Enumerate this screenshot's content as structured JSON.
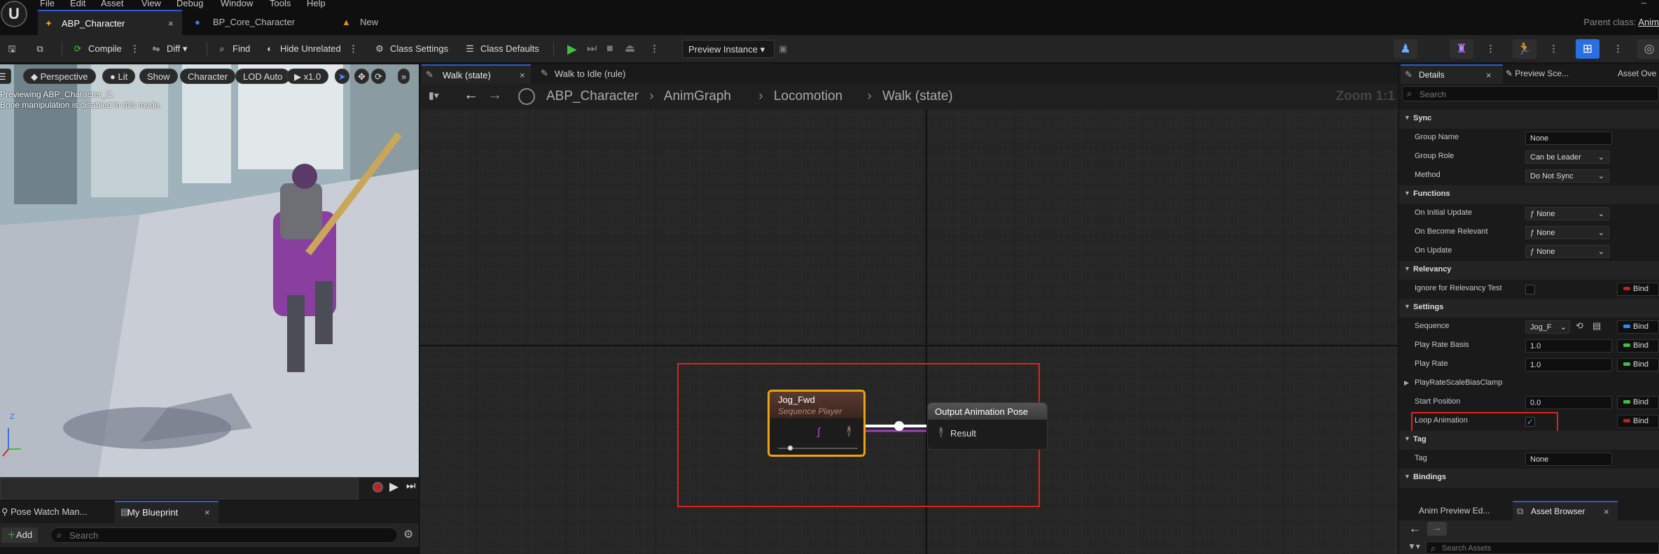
{
  "menu": [
    "File",
    "Edit",
    "Asset",
    "View",
    "Debug",
    "Window",
    "Tools",
    "Help"
  ],
  "tabs": [
    {
      "label": "ABP_Character",
      "close": "×"
    },
    {
      "label": "BP_Core_Character"
    },
    {
      "label": "New"
    }
  ],
  "parent_class": {
    "label": "Parent class:",
    "value": "Anim"
  },
  "toolbar": {
    "compile": "Compile",
    "diff": "Diff",
    "find": "Find",
    "hide_unrelated": "Hide Unrelated",
    "class_settings": "Class Settings",
    "class_defaults": "Class Defaults",
    "preview_instance": "Preview Instance"
  },
  "viewport": {
    "perspective": "Perspective",
    "lit": "Lit",
    "show": "Show",
    "character": "Character",
    "lod": "LOD Auto",
    "speed": "x1.0",
    "info_line1": "Previewing ABP_Character_C.",
    "info_line2": "Bone manipulation is disabled in this mode.",
    "axis_z": "Z"
  },
  "bottom_tabs": {
    "pose_watch": "Pose Watch Man...",
    "my_blueprint": "My Blueprint",
    "close": "×",
    "add": "Add",
    "search_placeholder": "Search"
  },
  "graph_tabs": {
    "walk_state": "Walk (state)",
    "walk_to_idle": "Walk to Idle (rule)",
    "close": "×"
  },
  "breadcrumb": [
    "ABP_Character",
    "AnimGraph",
    "Locomotion",
    "Walk (state)"
  ],
  "zoom": "Zoom 1:1",
  "nodes": {
    "seq_title": "Jog_Fwd",
    "seq_subtitle": "Sequence Player",
    "out_title": "Output Animation Pose",
    "out_pin": "Result"
  },
  "details": {
    "tab_details": "Details",
    "tab_preview": "Preview Sce...",
    "tab_asset": "Asset Ove",
    "close": "×",
    "search_placeholder": "Search",
    "cat_sync": "Sync",
    "group_name_label": "Group Name",
    "group_name": "None",
    "group_role_label": "Group Role",
    "group_role": "Can be Leader",
    "method_label": "Method",
    "method": "Do Not Sync",
    "cat_functions": "Functions",
    "on_initial_update_label": "On Initial Update",
    "on_initial_update": "None",
    "on_become_relevant_label": "On Become Relevant",
    "on_become_relevant": "None",
    "on_update_label": "On Update",
    "on_update": "None",
    "cat_relevancy": "Relevancy",
    "ignore_relevancy_label": "Ignore for Relevancy Test",
    "cat_settings": "Settings",
    "sequence_label": "Sequence",
    "sequence": "Jog_F",
    "play_rate_basis_label": "Play Rate Basis",
    "play_rate_basis": "1.0",
    "play_rate_label": "Play Rate",
    "play_rate": "1.0",
    "playrate_clamp_label": "PlayRateScaleBiasClamp",
    "start_position_label": "Start Position",
    "start_position": "0.0",
    "loop_animation_label": "Loop Animation",
    "loop_animation_checked": true,
    "cat_tag": "Tag",
    "tag_label": "Tag",
    "tag": "None",
    "cat_bindings": "Bindings",
    "bind": "Bind",
    "bottom_tab1": "Anim Preview Ed...",
    "bottom_tab2": "Asset Browser",
    "bottom_search": "Search Assets"
  },
  "colors": {
    "accent": "#2a5ad2",
    "highlight": "#e0231b",
    "node_border": "#f0a20a",
    "play_green": "#3fbf3f"
  }
}
